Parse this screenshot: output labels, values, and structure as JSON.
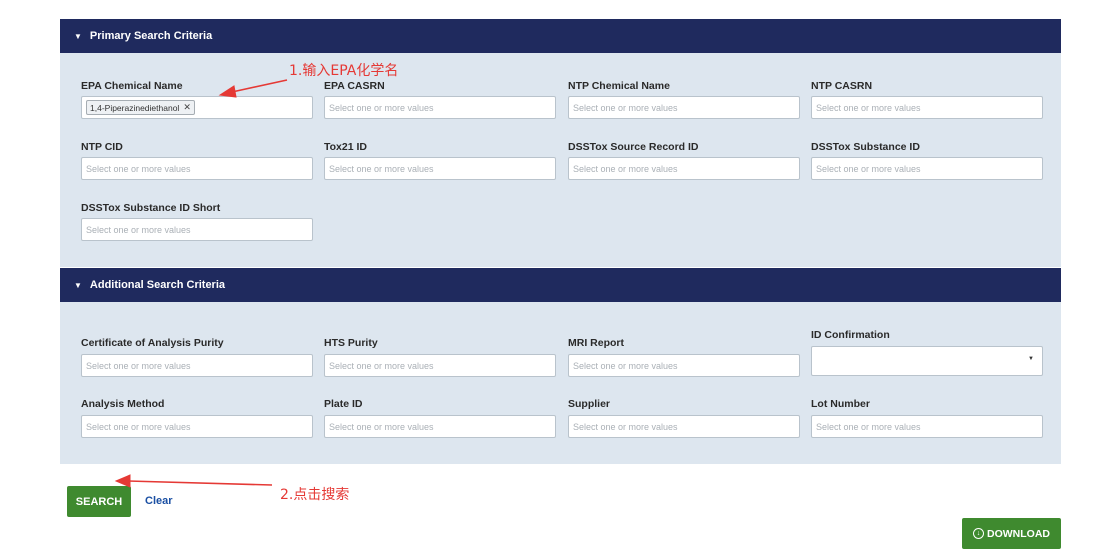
{
  "primary": {
    "header": "Primary Search Criteria",
    "fields": [
      {
        "label": "EPA Chemical Name",
        "tag": "1,4-Piperazinediethanol",
        "placeholder": ""
      },
      {
        "label": "EPA CASRN",
        "placeholder": "Select one or more values"
      },
      {
        "label": "NTP Chemical Name",
        "placeholder": "Select one or more values"
      },
      {
        "label": "NTP CASRN",
        "placeholder": "Select one or more values"
      },
      {
        "label": "NTP CID",
        "placeholder": "Select one or more values"
      },
      {
        "label": "Tox21 ID",
        "placeholder": "Select one or more values"
      },
      {
        "label": "DSSTox Source Record ID",
        "placeholder": "Select one or more values"
      },
      {
        "label": "DSSTox Substance ID",
        "placeholder": "Select one or more values"
      },
      {
        "label": "DSSTox Substance ID Short",
        "placeholder": "Select one or more values"
      }
    ]
  },
  "additional": {
    "header": "Additional Search Criteria",
    "fields": [
      {
        "label": "Certificate of Analysis Purity",
        "placeholder": "Select one or more values"
      },
      {
        "label": "HTS Purity",
        "placeholder": "Select one or more values"
      },
      {
        "label": "MRI Report",
        "placeholder": "Select one or more values"
      },
      {
        "label": "ID Confirmation",
        "placeholder": ""
      },
      {
        "label": "Analysis Method",
        "placeholder": "Select one or more values"
      },
      {
        "label": "Plate ID",
        "placeholder": "Select one or more values"
      },
      {
        "label": "Supplier",
        "placeholder": "Select one or more values"
      },
      {
        "label": "Lot Number",
        "placeholder": "Select one or more values"
      }
    ]
  },
  "actions": {
    "search": "SEARCH",
    "clear": "Clear",
    "download": "DOWNLOAD"
  },
  "annotations": {
    "step1": "1.输入EPA化学名",
    "step2": "2.点击搜索"
  },
  "colors": {
    "header_bg": "#1f2a5e",
    "panel_bg": "#dde6ef",
    "button_green": "#3f8a2f",
    "annotation_red": "#e53935"
  },
  "icons": {
    "collapse": "caret-down-icon",
    "tag_remove": "close-icon",
    "dropdown": "chevron-down-icon",
    "download": "download-icon"
  }
}
